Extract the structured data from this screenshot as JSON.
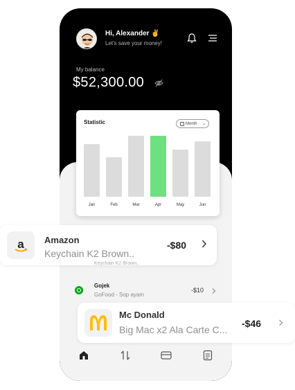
{
  "header": {
    "greeting": "Hi, Alexander ✌",
    "subtitle": "Let's save your money!"
  },
  "balance": {
    "label": "My balance",
    "value": "$52,300.00"
  },
  "statistic": {
    "title": "Statistic",
    "period_label": "Month"
  },
  "chart_data": {
    "type": "bar",
    "categories": [
      "Jan",
      "Feb",
      "Mar",
      "Apr",
      "May",
      "Jun"
    ],
    "values": [
      76,
      57,
      88,
      88,
      68,
      80
    ],
    "highlighted": "Apr",
    "colors": {
      "default": "#dcdcdc",
      "highlight": "#6fe07f"
    }
  },
  "transactions": {
    "amazon": {
      "name": "Amazon",
      "desc": "Keychain K2 Brown..",
      "amount": "-$80"
    },
    "ghost_desc": "Keychain K2 Brown..",
    "gojek": {
      "name": "Gojek",
      "desc": "GoFood - Sop ayam",
      "amount": "-$10"
    },
    "mcdonald": {
      "name": "Mc Donald",
      "desc": "Big Mac x2 Ala Carte C...",
      "amount": "-$46"
    }
  },
  "nav": {
    "items": [
      "home-icon",
      "transfer-icon",
      "card-icon",
      "document-icon"
    ]
  }
}
